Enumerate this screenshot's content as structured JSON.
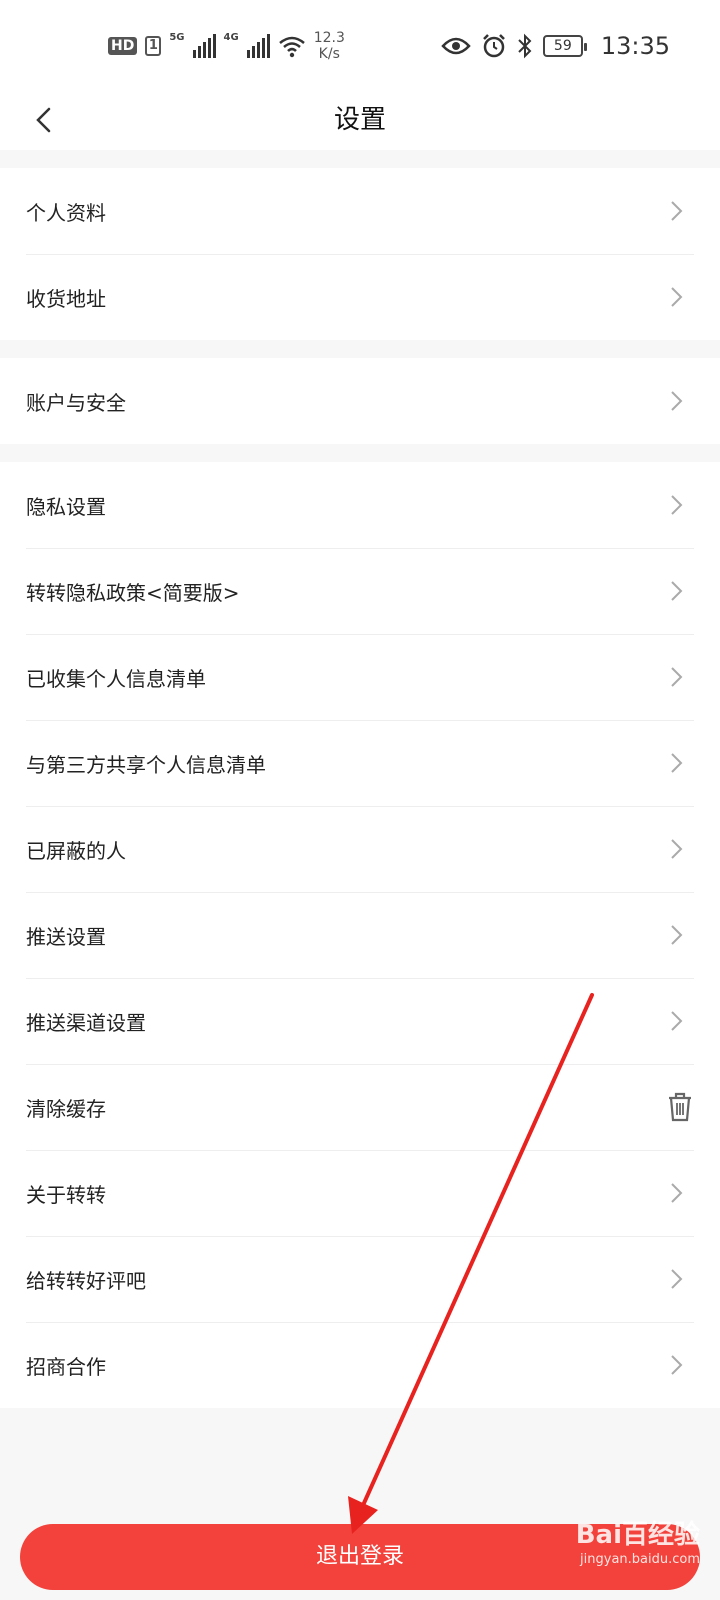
{
  "status_bar": {
    "hd": "HD",
    "sim": "1",
    "net1": "5G",
    "net2": "4G",
    "speed_value": "12.3",
    "speed_unit": "K/s",
    "battery": "59",
    "time": "13:35",
    "icons": [
      "eye-icon",
      "alarm-icon",
      "bluetooth-icon",
      "wifi-icon",
      "signal-icon",
      "battery-icon"
    ]
  },
  "header": {
    "title": "设置"
  },
  "groups": [
    {
      "items": [
        {
          "label": "个人资料"
        },
        {
          "label": "收货地址"
        }
      ]
    },
    {
      "items": [
        {
          "label": "账户与安全"
        }
      ]
    },
    {
      "items": [
        {
          "label": "隐私设置"
        },
        {
          "label": "转转隐私政策<简要版>"
        },
        {
          "label": "已收集个人信息清单"
        },
        {
          "label": "与第三方共享个人信息清单"
        },
        {
          "label": "已屏蔽的人"
        },
        {
          "label": "推送设置"
        },
        {
          "label": "推送渠道设置"
        },
        {
          "label": "清除缓存"
        },
        {
          "label": "关于转转"
        },
        {
          "label": "给转转好评吧"
        },
        {
          "label": "招商合作"
        }
      ]
    }
  ],
  "logout": {
    "label": "退出登录"
  },
  "watermark": {
    "brand": "Bai百经验",
    "site": "jingyan.baidu.com"
  },
  "colors": {
    "accent": "#f2423b",
    "background": "#f7f7f7",
    "annotation": "#e8231f"
  }
}
